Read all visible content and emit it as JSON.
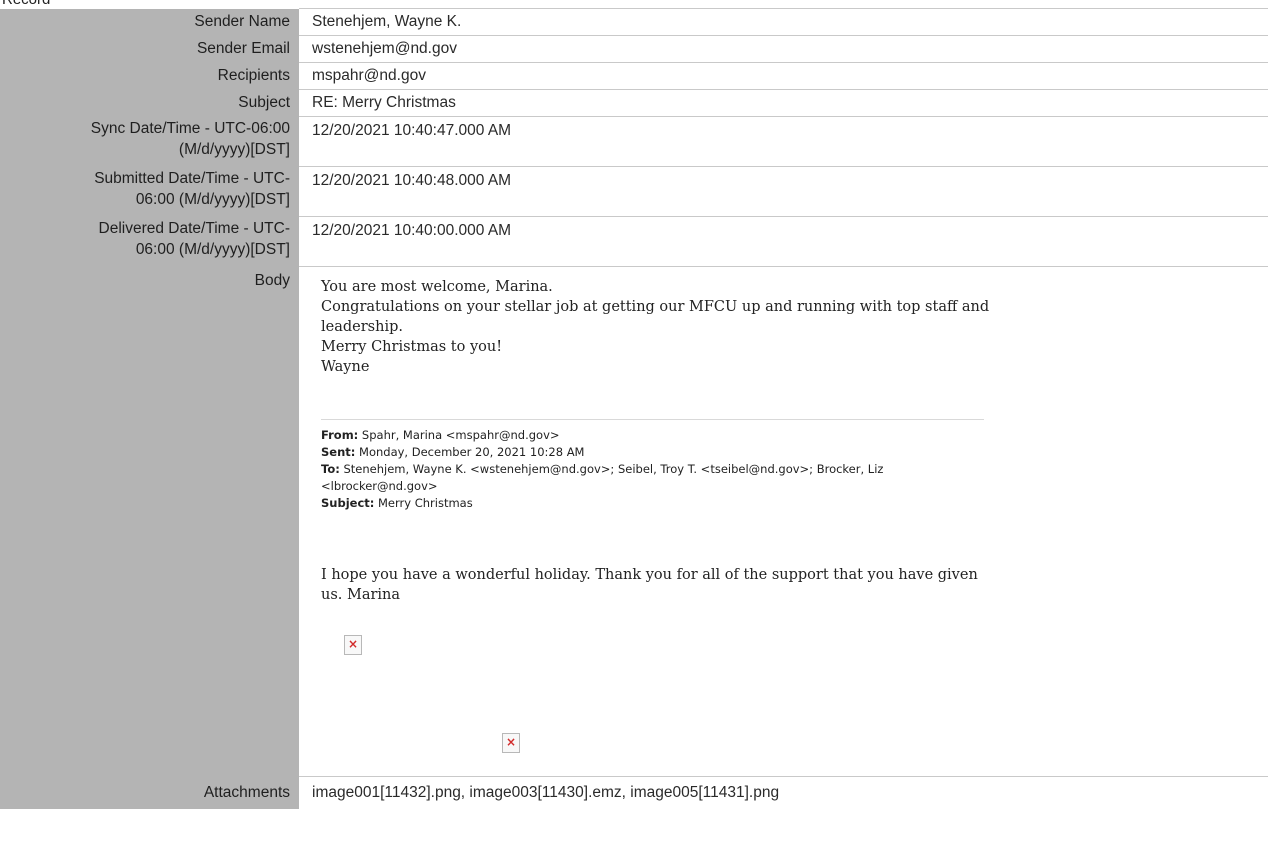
{
  "top_cut_text": "Record",
  "fields": {
    "sender_name": {
      "label": "Sender Name",
      "value": "Stenehjem, Wayne K."
    },
    "sender_email": {
      "label": "Sender Email",
      "value": "wstenehjem@nd.gov"
    },
    "recipients": {
      "label": "Recipients",
      "value": "mspahr@nd.gov"
    },
    "subject": {
      "label": "Subject",
      "value": "RE: Merry Christmas"
    },
    "sync": {
      "label_line1": "Sync Date/Time - UTC-06:00",
      "label_line2": "(M/d/yyyy)[DST]",
      "value": "12/20/2021 10:40:47.000 AM"
    },
    "submitted": {
      "label_line1": "Submitted Date/Time - UTC-",
      "label_line2": "06:00 (M/d/yyyy)[DST]",
      "value": "12/20/2021 10:40:48.000 AM"
    },
    "delivered": {
      "label_line1": "Delivered Date/Time - UTC-",
      "label_line2": "06:00 (M/d/yyyy)[DST]",
      "value": "12/20/2021 10:40:00.000 AM"
    },
    "body": {
      "label": "Body"
    },
    "attachments": {
      "label": "Attachments",
      "value": "image001[11432].png, image003[11430].emz, image005[11431].png"
    }
  },
  "email_body": {
    "line1": "You are most welcome, Marina.",
    "line2": "Congratulations on your stellar job at getting our MFCU up and running with top staff and",
    "line3": "leadership.",
    "line4": "Merry Christmas to you!",
    "line5": "Wayne",
    "header": {
      "from_label": "From:",
      "from_value": " Spahr, Marina <mspahr@nd.gov>",
      "sent_label": "Sent:",
      "sent_value": " Monday, December 20, 2021 10:28 AM",
      "to_label": "To:",
      "to_value_line1": " Stenehjem, Wayne K. <wstenehjem@nd.gov>; Seibel, Troy T. <tseibel@nd.gov>; Brocker, Liz",
      "to_value_line2": "<lbrocker@nd.gov>",
      "subject_label": "Subject:",
      "subject_value": " Merry Christmas"
    },
    "reply_line1": "I hope you have a wonderful holiday.  Thank you for all of the support that you have given",
    "reply_line2": "us.  Marina",
    "broken_image_icon": "broken-image-icon",
    "broken_image_glyph": "×"
  }
}
